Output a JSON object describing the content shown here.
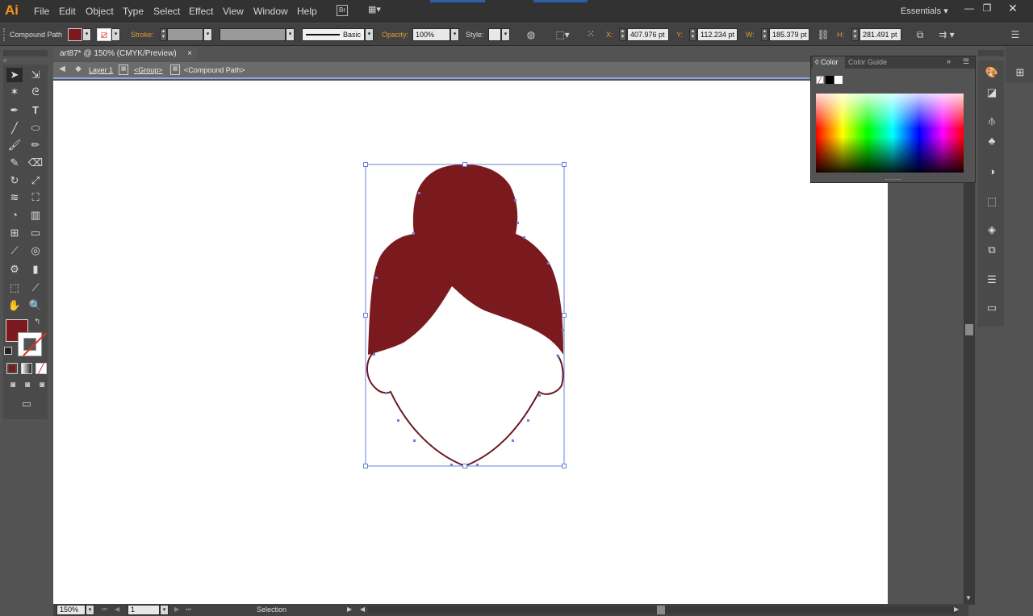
{
  "app": {
    "logo": "Ai",
    "workspace": "Essentials ▾"
  },
  "menu": [
    "File",
    "Edit",
    "Object",
    "Type",
    "Select",
    "Effect",
    "View",
    "Window",
    "Help"
  ],
  "control": {
    "selection_type": "Compound Path",
    "fill_color": "#7b1a1e",
    "stroke_label": "Stroke:",
    "brush_style": "Basic",
    "opacity_label": "Opacity:",
    "opacity_value": "100%",
    "style_label": "Style:",
    "x_label": "X:",
    "x_value": "407.976 pt",
    "y_label": "Y:",
    "y_value": "112.234 pt",
    "w_label": "W:",
    "w_value": "185.379 pt",
    "h_label": "H:",
    "h_value": "281.491 pt"
  },
  "document": {
    "tab_title": "art87* @ 150% (CMYK/Preview)",
    "tab_close": "×",
    "breadcrumb": {
      "layer": "Layer 1",
      "group": "<Group>",
      "path": "<Compound Path>"
    }
  },
  "color_panel": {
    "tab_color": "Color",
    "tab_guide": "Color Guide"
  },
  "status": {
    "zoom": "150%",
    "artboard": "1",
    "tool": "Selection"
  },
  "artwork": {
    "hair_color": "#7b1a1e",
    "selection_color": "#6b80d8"
  },
  "colors": {
    "accent": "#f7941d",
    "stroke_label": "#e3963b",
    "selection": "#8ba6e0"
  }
}
